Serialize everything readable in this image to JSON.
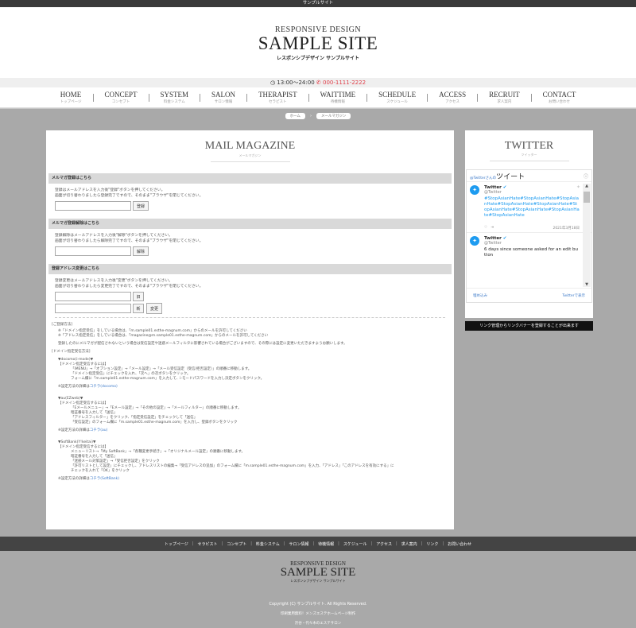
{
  "topbar": {
    "text": "サンプルサイト"
  },
  "header": {
    "sub": "RESPONSIVE DESIGN",
    "main": "SAMPLE SITE",
    "jp": "レスポンシブデザイン サンプルサイト"
  },
  "info": {
    "hours": "13:00〜24:00",
    "tel": "000-1111-2222",
    "accent": "#e0404a"
  },
  "nav": [
    {
      "en": "HOME",
      "jp": "トップページ"
    },
    {
      "en": "CONCEPT",
      "jp": "コンセプト"
    },
    {
      "en": "SYSTEM",
      "jp": "料金システム"
    },
    {
      "en": "SALON",
      "jp": "サロン情報"
    },
    {
      "en": "THERAPIST",
      "jp": "セラピスト"
    },
    {
      "en": "WAITTIME",
      "jp": "待機情報"
    },
    {
      "en": "SCHEDULE",
      "jp": "スケジュール"
    },
    {
      "en": "ACCESS",
      "jp": "アクセス"
    },
    {
      "en": "RECRUIT",
      "jp": "求人案内"
    },
    {
      "en": "CONTACT",
      "jp": "お問い合わせ"
    }
  ],
  "breadcrumb": {
    "home": "ホーム",
    "sep": "›",
    "current": "メールマガジン"
  },
  "mail": {
    "title_en": "MAIL MAGAZINE",
    "title_jp": "メールマガジン",
    "register": {
      "heading": "メルマガ登録はこちら",
      "text1": "登録はメールアドレスを入力後\"登録\"ボタンを押してください。",
      "text2": "画面が切り替わりましたら登録完了ですので、そのまま\"ブラウザ\"を閉じてください。",
      "button": "登録"
    },
    "cancel": {
      "heading": "メルマガ登録解除はこちら",
      "text1": "登録解除はメールアドレスを入力後\"解除\"ボタンを押してください。",
      "text2": "画面が切り替わりましたら解除完了ですので、そのまま\"ブラウザ\"を閉じてください。",
      "button": "解除"
    },
    "change": {
      "heading": "登録アドレス変更はこちら",
      "text1": "登録変更はメールアドレスを入力後\"変更\"ボタンを押してください。",
      "text2": "画面が切り替わりましたら変更完了ですので、そのまま\"ブラウザ\"を閉じてください。",
      "old_label": "旧",
      "new_label": "新",
      "button": "変更"
    },
    "help": {
      "h1": "[ご登録方法]",
      "l1": "※「ドメイン指定受信」をしている場合は、「m.sample01.esthe-magnum.com」からのメールを許可してください",
      "l2": "※「アドレス指定受信」をしている場合は、「magazine@m.sample01.esthe-magnum.com」からのメールを許可してください",
      "l3": "登録したのにメルマガが配信されないという場合は受信設定や迷惑メールフィルタに影響されている場合がございますので、その際には設定に変更いただきますようお願いします。",
      "h2": "[ドメイン指定受信方法]",
      "d_head": "▼docomo(i-mode)▼",
      "d_sub": "【ドメイン指定受信するには】",
      "d1": "「iMENU」→「オプション設定」→「メール設定」→「メール受信設定（受信/拒否設定）」の順番に移動します。",
      "d2": "「ドメイン指定受信」にチェックを入れ、「次へ」の次ボタンをクリック。",
      "d3": "フォーム欄に「m.sample01.esthe-magnum.com」を入力して、i-モードパスワードを入力し決定ボタンをクリック。",
      "d_link_pre": "※設定方法の詳細は",
      "d_link": "コチラ(docomo)",
      "a_head": "▼au(EZweb)▼",
      "a_sub": "【ドメイン指定受信するには】",
      "a1": "「Eメールメニュー」→「Eメール設定」→「その他の設定」→「メールフィルター」の順番に移動します。",
      "a2": "暗証番号を入力して「送信」",
      "a3": "「アドレスフィルター」をクリック、「指定受信設定」をチェックして「送信」",
      "a4": "「受信設定」のフォーム欄に「m.sample01.esthe-magnum.com」を入力し、登録ボタンをクリック",
      "a_link_pre": "※設定方法の詳細は",
      "a_link": "コチラ(au)",
      "s_head": "▼SoftBank(Y!keitai)▼",
      "s_sub": "【ドメイン指定受信するには】",
      "s1": "メニューリスト→「My SoftBank」→「各種変更手続き」→「オリジナルメール設定」の順番に移動します。",
      "s2": "暗証番号を入力して「送信」",
      "s3": "「迷惑メール対策設定」→「受信拒否設定」をクリック",
      "s4": "「許可リストとして設定」にチェックし、アドレスリストの編集→「受信アドレスの追加」のフォーム欄に「m.sample01.esthe-magnum.com」を入力、「アドレス」「このアドレスを有効にする」に",
      "s5": "チェックを入れて「OK」をクリック",
      "s_link_pre": "※設定方法の詳細は",
      "s_link": "コチラ(SoftBank)",
      "link_color": "#3a78c8"
    }
  },
  "twitter": {
    "title_en": "TWITTER",
    "title_jp": "ツイッター",
    "owner_label": "@Twitterさんの",
    "tweets_label": "ツイート",
    "tweet1": {
      "name": "Twitter",
      "handle": "@Twitter",
      "text": "#StopAsianHate#StopAsianHate#StopAsianHate#StopAsianHate#StopAsianHate#StopAsianHate#StopAsianHate#StopAsianHate#StopAsianHate",
      "date": "2021年3月18日"
    },
    "tweet2": {
      "name": "Twitter",
      "handle": "@Twitter",
      "text": "6 days since someone asked for an edit button"
    },
    "embed": "埋め込み",
    "view_on": "Twitterで表示",
    "brand": "#1d9bf0"
  },
  "banner": "リンク管理からリンクバナーを登録することが出来ます",
  "footer_nav": [
    "トップページ",
    "セラピスト",
    "コンセプト",
    "料金システム",
    "サロン情報",
    "待機情報",
    "スケジュール",
    "アクセス",
    "求人案内",
    "リンク",
    "お問い合わせ"
  ],
  "footer": {
    "sub": "RESPONSIVE DESIGN",
    "main": "SAMPLE SITE",
    "jp": "レスポンシブデザイン サンプルサイト",
    "copy": "Copyright (C) サンプルサイト. All Rights Reserved.",
    "line2": "印刷業用無料！メンズエステホームページ制作",
    "line3": "渋谷・代々木のエステサロン"
  }
}
